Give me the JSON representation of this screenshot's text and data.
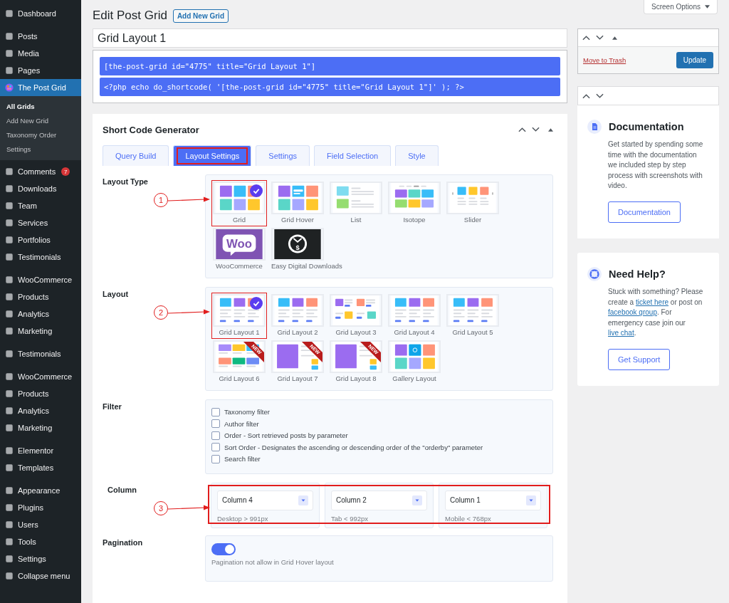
{
  "sidebar": {
    "groups": [
      {
        "items": [
          {
            "label": "Dashboard",
            "selected": false
          }
        ]
      },
      {
        "items": [
          {
            "label": "Posts",
            "selected": false
          },
          {
            "label": "Media",
            "selected": false
          },
          {
            "label": "Pages",
            "selected": false
          },
          {
            "label": "The Post Grid",
            "selected": true,
            "children": [
              {
                "label": "All Grids",
                "selected": true
              },
              {
                "label": "Add New Grid",
                "selected": false
              },
              {
                "label": "Taxonomy Order",
                "selected": false
              },
              {
                "label": "Settings",
                "selected": false
              }
            ]
          },
          {
            "label": "Comments",
            "selected": false,
            "badge": "7"
          },
          {
            "label": "Downloads",
            "selected": false
          },
          {
            "label": "Team",
            "selected": false
          },
          {
            "label": "Services",
            "selected": false
          },
          {
            "label": "Portfolios",
            "selected": false
          },
          {
            "label": "Testimonials",
            "selected": false
          }
        ]
      },
      {
        "items": [
          {
            "label": "WooCommerce",
            "selected": false
          },
          {
            "label": "Products",
            "selected": false
          },
          {
            "label": "Analytics",
            "selected": false
          },
          {
            "label": "Marketing",
            "selected": false
          }
        ]
      },
      {
        "items": [
          {
            "label": "Testimonials",
            "selected": false
          }
        ]
      },
      {
        "items": [
          {
            "label": "WooCommerce",
            "selected": false
          },
          {
            "label": "Products",
            "selected": false
          },
          {
            "label": "Analytics",
            "selected": false
          },
          {
            "label": "Marketing",
            "selected": false
          }
        ]
      },
      {
        "items": [
          {
            "label": "Elementor",
            "selected": false
          },
          {
            "label": "Templates",
            "selected": false
          }
        ]
      },
      {
        "items": [
          {
            "label": "Appearance",
            "selected": false
          },
          {
            "label": "Plugins",
            "selected": false
          },
          {
            "label": "Users",
            "selected": false
          },
          {
            "label": "Tools",
            "selected": false
          },
          {
            "label": "Settings",
            "selected": false
          },
          {
            "label": "Collapse menu",
            "selected": false
          }
        ]
      }
    ]
  },
  "header": {
    "title": "Edit Post Grid",
    "add_button": "Add New Grid",
    "screen_options": "Screen Options"
  },
  "post_title": "Grid Layout 1",
  "shortcodes": [
    "[the-post-grid id=\"4775\" title=\"Grid Layout 1\"]",
    "<?php echo do_shortcode( '[the-post-grid id=\"4775\" title=\"Grid Layout 1\"]' ); ?>"
  ],
  "generator": {
    "title": "Short Code Generator",
    "tabs": [
      {
        "label": "Query Build",
        "selected": false
      },
      {
        "label": "Layout Settings",
        "selected": true
      },
      {
        "label": "Settings",
        "selected": false
      },
      {
        "label": "Field Selection",
        "selected": false
      },
      {
        "label": "Style",
        "selected": false
      }
    ],
    "sections": [
      {
        "kind": "thumbs",
        "label": "Layout Type",
        "callout": "1",
        "options": [
          {
            "label": "Grid",
            "kind": "grid",
            "selected": true
          },
          {
            "label": "Grid Hover",
            "kind": "hover",
            "selected": false
          },
          {
            "label": "List",
            "kind": "list",
            "selected": false
          },
          {
            "label": "Isotope",
            "kind": "isotope",
            "selected": false
          },
          {
            "label": "Slider",
            "kind": "slider",
            "selected": false
          },
          {
            "label": "WooCommerce",
            "kind": "woo",
            "logo_text": "Woo",
            "selected": false
          },
          {
            "label": "Easy Digital Downloads",
            "kind": "edd",
            "logo_text": "$",
            "selected": false
          }
        ]
      },
      {
        "kind": "thumbs",
        "label": "Layout",
        "callout": "2",
        "options": [
          {
            "label": "Grid Layout 1",
            "kind": "cards",
            "selected": true
          },
          {
            "label": "Grid Layout 2",
            "kind": "cards",
            "selected": false
          },
          {
            "label": "Grid Layout 3",
            "kind": "mixed",
            "selected": false
          },
          {
            "label": "Grid Layout 4",
            "kind": "cards",
            "selected": false
          },
          {
            "label": "Grid Layout 5",
            "kind": "cards",
            "selected": false
          },
          {
            "label": "Grid Layout 6",
            "kind": "mosaic",
            "badge": "NEW",
            "selected": false
          },
          {
            "label": "Grid Layout 7",
            "kind": "feature",
            "badge": "NEW",
            "selected": false
          },
          {
            "label": "Grid Layout 8",
            "kind": "feature",
            "badge": "NEW",
            "selected": false
          },
          {
            "label": "Gallery Layout",
            "kind": "gallery",
            "selected": false
          }
        ]
      },
      {
        "kind": "checkboxes",
        "label": "Filter",
        "options": [
          {
            "label": "Taxonomy filter",
            "checked": false
          },
          {
            "label": "Author filter",
            "checked": false
          },
          {
            "label": "Order - Sort retrieved posts by parameter",
            "checked": false
          },
          {
            "label": "Sort Order - Designates the ascending or descending order of the \"orderby\" parameter",
            "checked": false
          },
          {
            "label": "Search filter",
            "checked": false
          }
        ]
      },
      {
        "kind": "columns",
        "label": "Column",
        "callout": "3",
        "highlighted": true,
        "columns": [
          {
            "value": "Column 4",
            "hint": "Desktop > 991px"
          },
          {
            "value": "Column 2",
            "hint": "Tab < 992px"
          },
          {
            "value": "Column 1",
            "hint": "Mobile < 768px"
          }
        ]
      },
      {
        "kind": "toggle",
        "label": "Pagination",
        "on": true,
        "hint": "Pagination not allow in Grid Hover layout"
      }
    ]
  },
  "publish": {
    "trash": "Move to Trash",
    "update": "Update"
  },
  "documentation": {
    "title": "Documentation",
    "text": "Get started by spending some time with the documentation we included step by step process with screenshots with video.",
    "button": "Documentation"
  },
  "help": {
    "title": "Need Help?",
    "segments": [
      {
        "text": "Stuck with something? Please create a "
      },
      {
        "text": "ticket here",
        "link": true
      },
      {
        "text": " or post on "
      },
      {
        "text": "facebook group",
        "link": true
      },
      {
        "text": ". For emergency case join our "
      },
      {
        "text": "live chat",
        "link": true
      },
      {
        "text": "."
      }
    ],
    "button": "Get Support"
  }
}
